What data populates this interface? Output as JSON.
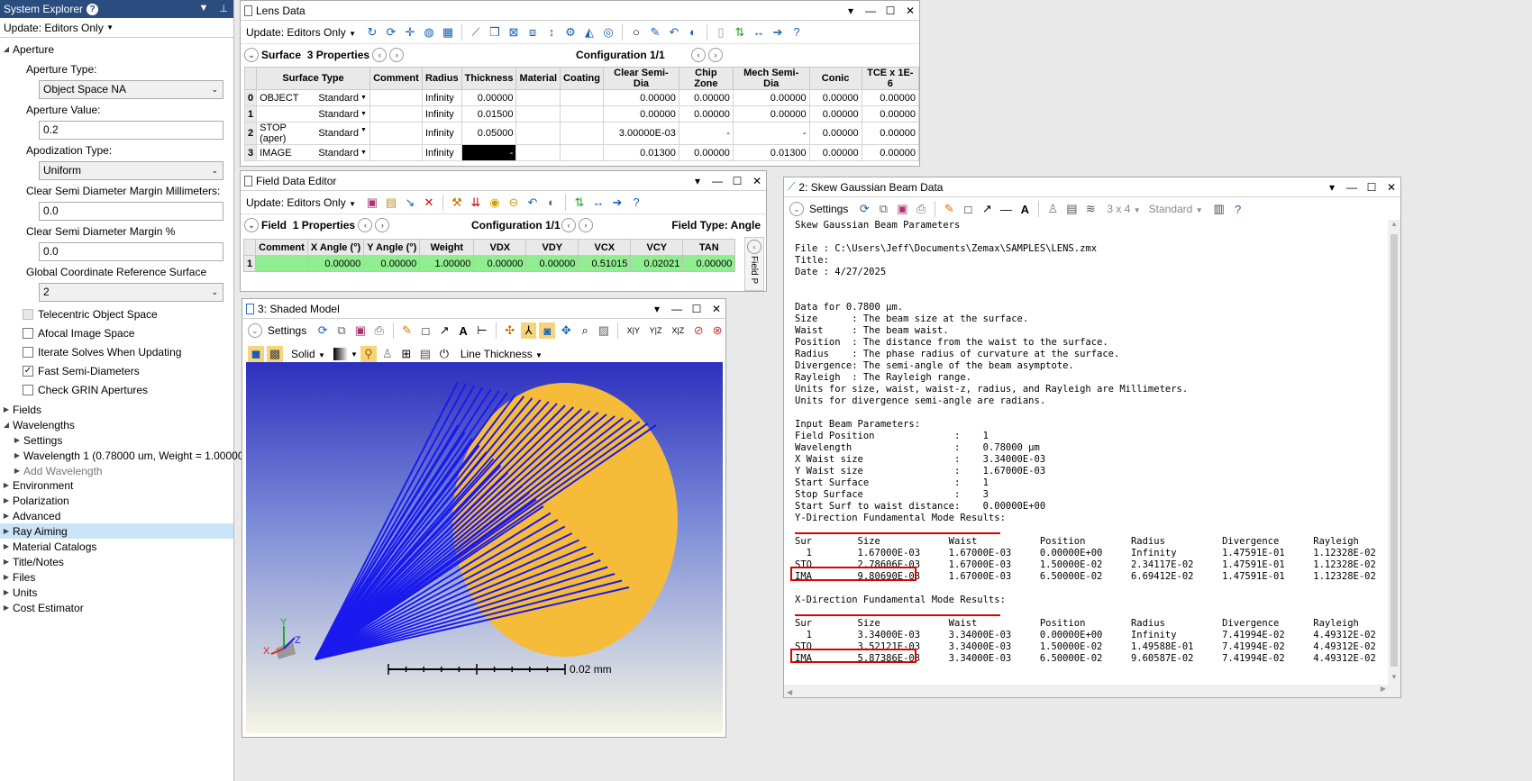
{
  "system_explorer": {
    "title": "System Explorer",
    "update": "Update: Editors Only",
    "aperture": {
      "label": "Aperture",
      "type_label": "Aperture Type:",
      "type_value": "Object Space NA",
      "value_label": "Aperture Value:",
      "value": "0.2",
      "apod_label": "Apodization Type:",
      "apod_value": "Uniform",
      "csd_mm_label": "Clear Semi Diameter Margin Millimeters:",
      "csd_mm_value": "0.0",
      "csd_pct_label": "Clear Semi Diameter Margin %",
      "csd_pct_value": "0.0",
      "gcrs_label": "Global Coordinate Reference Surface",
      "gcrs_value": "2",
      "checks": [
        {
          "label": "Telecentric Object Space",
          "checked": false
        },
        {
          "label": "Afocal Image Space",
          "checked": false
        },
        {
          "label": "Iterate Solves When Updating",
          "checked": false
        },
        {
          "label": "Fast Semi-Diameters",
          "checked": true
        },
        {
          "label": "Check GRIN Apertures",
          "checked": false
        }
      ]
    },
    "fields": "Fields",
    "wavelengths": "Wavelengths",
    "settings": "Settings",
    "wavelength1": "Wavelength 1 (0.78000 um, Weight = 1.00000)",
    "add_wavelength": "Add Wavelength",
    "items": [
      "Environment",
      "Polarization",
      "Advanced",
      "Ray Aiming",
      "Material Catalogs",
      "Title/Notes",
      "Files",
      "Units",
      "Cost Estimator"
    ]
  },
  "lens_data": {
    "title": "Lens Data",
    "update": "Update: Editors Only",
    "surface_label": "Surface",
    "properties": "3 Properties",
    "configuration": "Configuration 1/1",
    "columns": [
      "",
      "Surface Type",
      "",
      "Comment",
      "Radius",
      "Thickness",
      "Material",
      "Coating",
      "Clear Semi-Dia",
      "Chip Zone",
      "Mech Semi-Dia",
      "Conic",
      "TCE x 1E-6"
    ],
    "rows": [
      [
        "0",
        "OBJECT",
        "Standard",
        "",
        "Infinity",
        "0.00000",
        "",
        "",
        "0.00000",
        "0.00000",
        "0.00000",
        "0.00000",
        "0.00000"
      ],
      [
        "1",
        "",
        "Standard",
        "",
        "Infinity",
        "0.01500",
        "",
        "",
        "0.00000",
        "0.00000",
        "0.00000",
        "0.00000",
        "0.00000"
      ],
      [
        "2",
        "STOP (aper)",
        "Standard",
        "",
        "Infinity",
        "0.05000",
        "",
        "",
        "3.00000E-03",
        "-",
        "-",
        "0.00000",
        "0.00000"
      ],
      [
        "3",
        "IMAGE",
        "Standard",
        "",
        "Infinity",
        "-",
        "",
        "",
        "0.01300",
        "0.00000",
        "0.01300",
        "0.00000",
        "0.00000"
      ]
    ]
  },
  "field_data": {
    "title": "Field Data Editor",
    "update": "Update: Editors Only",
    "field_label": "Field",
    "properties": "1 Properties",
    "configuration": "Configuration 1/1",
    "field_type": "Field Type: Angle",
    "columns": [
      "",
      "Comment",
      "X Angle (°)",
      "Y Angle (°)",
      "Weight",
      "VDX",
      "VDY",
      "VCX",
      "VCY",
      "TAN"
    ],
    "rows": [
      [
        "1",
        "",
        "0.00000",
        "0.00000",
        "1.00000",
        "0.00000",
        "0.00000",
        "0.51015",
        "0.02021",
        "0.00000"
      ]
    ],
    "side_tab": "Field P"
  },
  "shaded_model": {
    "title": "3: Shaded Model",
    "settings": "Settings",
    "solid": "Solid",
    "line_thickness": "Line Thickness",
    "scale": "0.02 mm",
    "axis_x": "X",
    "axis_y": "Y",
    "axis_z": "Z",
    "colors": {
      "disk": "#f7bb3a",
      "rays": "#1a1aee",
      "bg_top": "#2d2fbf",
      "bg_bottom": "#f6f6e4"
    }
  },
  "gaussian": {
    "title": "2: Skew Gaussian Beam Data",
    "settings": "Settings",
    "grid": "3 x 4",
    "standard": "Standard",
    "text_top": "Skew Gaussian Beam Parameters\n\nFile : C:\\Users\\Jeff\\Documents\\Zemax\\SAMPLES\\LENS.zmx\nTitle:\nDate : 4/27/2025\n\n\nData for 0.7800 µm.\nSize      : The beam size at the surface.\nWaist     : The beam waist.\nPosition  : The distance from the waist to the surface.\nRadius    : The phase radius of curvature at the surface.\nDivergence: The semi-angle of the beam asymptote.\nRayleigh  : The Rayleigh range.\nUnits for size, waist, waist-z, radius, and Rayleigh are Millimeters.\nUnits for divergence semi-angle are radians.\n\nInput Beam Parameters:\nField Position              :    1\nWavelength                  :    0.78000 µm\nX Waist size                :    3.34000E-03\nY Waist size                :    1.67000E-03\nStart Surface               :    1\nStop Surface                :    3\nStart Surf to waist distance:    0.00000E+00\n",
    "y_heading": "Y-Direction Fundamental Mode Results:",
    "y_table": "Sur        Size            Waist           Position        Radius          Divergence      Rayleigh\n  1        1.67000E-03     1.67000E-03     0.00000E+00     Infinity        1.47591E-01     1.12328E-02\nSTO        2.78606E-03     1.67000E-03     1.50000E-02     2.34117E-02     1.47591E-01     1.12328E-02\nIMA        9.80690E-03     1.67000E-03     6.50000E-02     6.69412E-02     1.47591E-01     1.12328E-02",
    "x_heading": "X-Direction Fundamental Mode Results:",
    "x_table": "Sur        Size            Waist           Position        Radius          Divergence      Rayleigh\n  1        3.34000E-03     3.34000E-03     0.00000E+00     Infinity        7.41994E-02     4.49312E-02\nSTO        3.52121E-03     3.34000E-03     1.50000E-02     1.49588E-01     7.41994E-02     4.49312E-02\nIMA        5.87386E-03     3.34000E-03     6.50000E-02     9.60587E-02     7.41994E-02     4.49312E-02"
  }
}
